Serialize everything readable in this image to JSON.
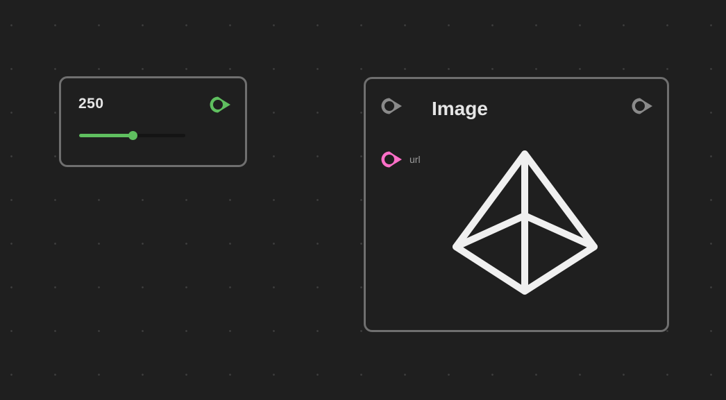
{
  "slider_node": {
    "value_label": "250",
    "value_fraction": 0.5,
    "accent_color": "#5fbf5f",
    "output_port_icon": "output-port-icon"
  },
  "image_node": {
    "title": "Image",
    "inputs": [
      {
        "label": "url",
        "port_color": "#ff6fc8"
      }
    ],
    "input_port_color": "#8a8a8a",
    "output_port_color": "#8a8a8a",
    "placeholder_icon": "pyramid-placeholder-icon"
  }
}
